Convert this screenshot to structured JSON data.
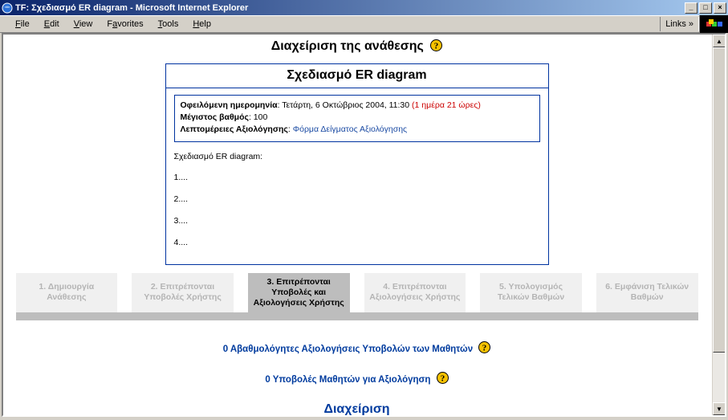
{
  "window": {
    "title": "TF: Σχεδιασμό ER diagram - Microsoft Internet Explorer"
  },
  "menu": {
    "file": "File",
    "edit": "Edit",
    "view": "View",
    "favorites": "Favorites",
    "tools": "Tools",
    "help": "Help",
    "links": "Links"
  },
  "page": {
    "heading": "Διαχείριση της ανάθεσης"
  },
  "assignment": {
    "title": "Σχεδιασμό ER diagram",
    "due_label": "Οφειλόμενη ημερομηνία",
    "due_value": "Τετάρτη, 6 Οκτώβριος 2004, 11:30",
    "due_remaining": "(1 ημέρα 21 ώρες)",
    "maxgrade_label": "Μέγιστος βαθμός",
    "maxgrade_value": "100",
    "details_label": "Λεπτομέρειες Αξιολόγησης",
    "details_link": "Φόρμα Δείγματος Αξιολόγησης",
    "desc_intro": "Σχεδιασμό ER diagram:",
    "desc_items": {
      "i1": "1....",
      "i2": "2....",
      "i3": "3....",
      "i4": "4...."
    }
  },
  "tabs": {
    "t1": "1. Δημιουργία Ανάθεσης",
    "t2": "2. Επιτρέπονται Υποβολές Χρήστης",
    "t3": "3. Επιτρέπονται Υποβολές και Αξιολογήσεις Χρήστης",
    "t4": "4. Επιτρέπονται Αξιολογήσεις Χρήστης",
    "t5": "5. Υπολογισμός Τελικών Βαθμών",
    "t6": "6. Εμφάνιση Τελικών Βαθμών"
  },
  "actions": {
    "ungraded": "0 Αβαθμολόγητες Αξιολογήσεις Υποβολών των Μαθητών",
    "submissions": "0 Υποβολές Μαθητών για Αξιολόγηση"
  },
  "bottom_heading": "Διαχείριση"
}
